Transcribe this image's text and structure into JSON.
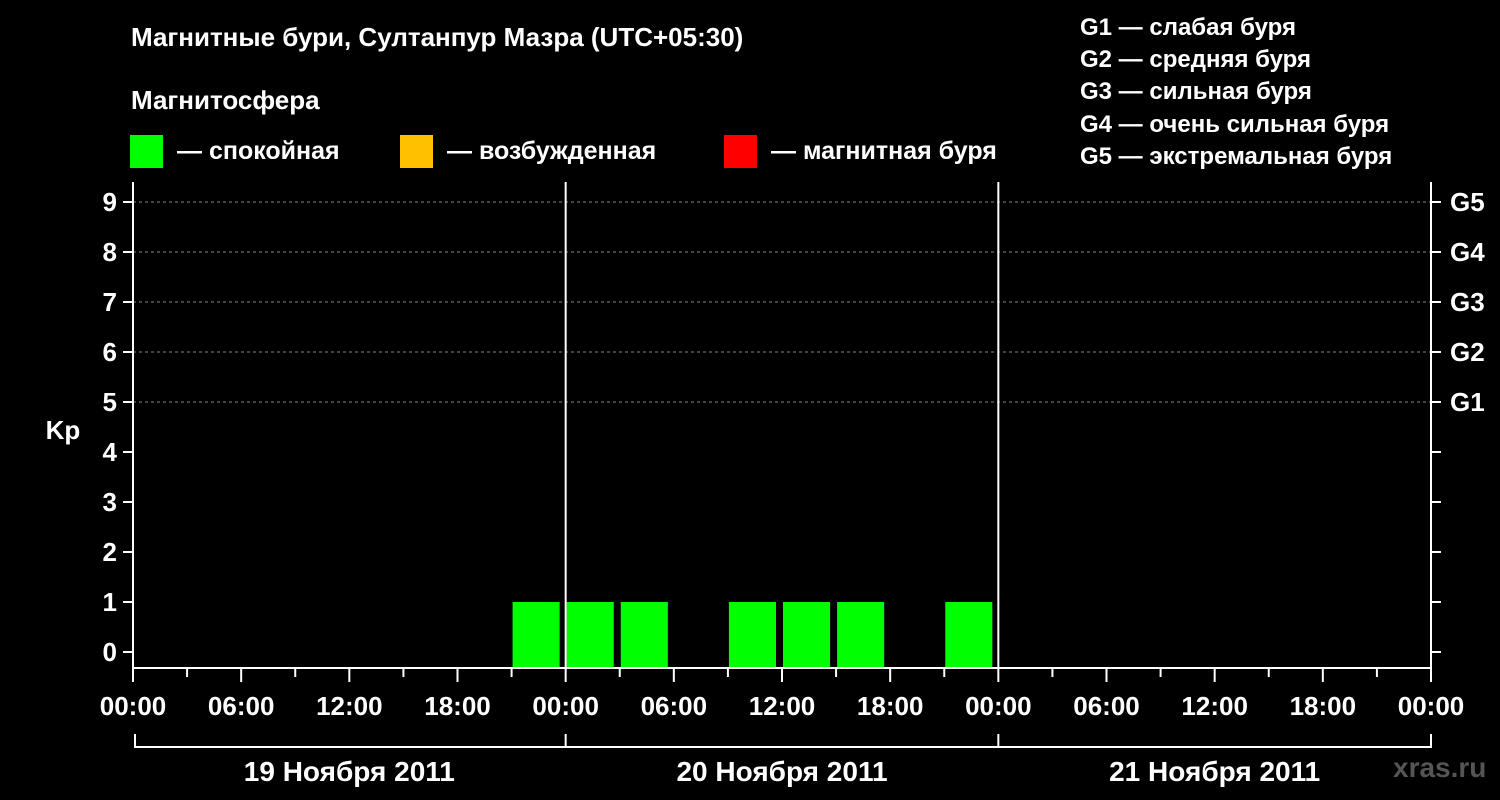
{
  "header": {
    "title": "Магнитные бури, Султанпур Мазра (UTC+05:30)",
    "subtitle": "Магнитосфера"
  },
  "legend": [
    {
      "label": "— спокойная",
      "color": "#00ff00"
    },
    {
      "label": "— возбужденная",
      "color": "#ffc000"
    },
    {
      "label": "— магнитная буря",
      "color": "#ff0000"
    }
  ],
  "g_scale": [
    "G1 — слабая буря",
    "G2 — средняя буря",
    "G3 — сильная буря",
    "G4 — очень сильная буря",
    "G5 — экстремальная буря"
  ],
  "watermark": "xras.ru",
  "chart_data": {
    "type": "bar",
    "ylabel": "Kp",
    "ylim": [
      0,
      9
    ],
    "y_ticks": [
      "0",
      "1",
      "2",
      "3",
      "4",
      "5",
      "6",
      "7",
      "8",
      "9"
    ],
    "right_ticks": [
      {
        "y": 5,
        "label": "G1"
      },
      {
        "y": 6,
        "label": "G2"
      },
      {
        "y": 7,
        "label": "G3"
      },
      {
        "y": 8,
        "label": "G4"
      },
      {
        "y": 9,
        "label": "G5"
      }
    ],
    "x_range_hours": [
      0,
      72
    ],
    "x_tick_labels": [
      "00:00",
      "06:00",
      "12:00",
      "18:00",
      "00:00",
      "06:00",
      "12:00",
      "18:00",
      "00:00",
      "06:00",
      "12:00",
      "18:00",
      "00:00"
    ],
    "days": [
      "19 Ноября 2011",
      "20 Ноября 2011",
      "21 Ноября 2011"
    ],
    "grid": "dashed horizontal at Kp 5–9",
    "bars": [
      {
        "start_hour": 21,
        "kp": 1,
        "color": "#00ff00"
      },
      {
        "start_hour": 24,
        "kp": 1,
        "color": "#00ff00"
      },
      {
        "start_hour": 27,
        "kp": 1,
        "color": "#00ff00"
      },
      {
        "start_hour": 33,
        "kp": 1,
        "color": "#00ff00"
      },
      {
        "start_hour": 36,
        "kp": 1,
        "color": "#00ff00"
      },
      {
        "start_hour": 39,
        "kp": 1,
        "color": "#00ff00"
      },
      {
        "start_hour": 45,
        "kp": 1,
        "color": "#00ff00"
      }
    ]
  }
}
